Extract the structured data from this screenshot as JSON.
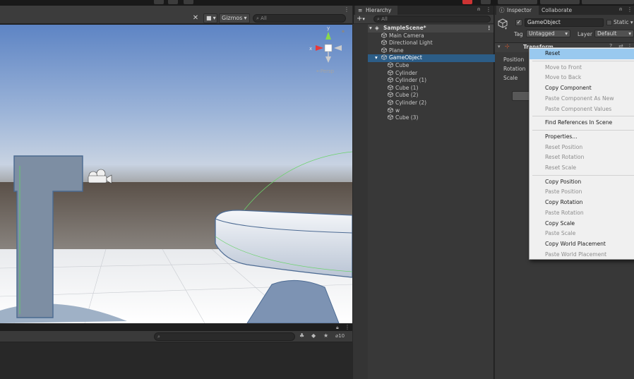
{
  "scene": {
    "gizmos_label": "Gizmos",
    "search_placeholder": "All",
    "persp_label": "←Persp"
  },
  "bottom": {
    "search_placeholder": "",
    "count": "10"
  },
  "hierarchy": {
    "tab": "Hierarchy",
    "add_label": "+",
    "search_placeholder": "All",
    "scene_name": "SampleScene*",
    "items": [
      {
        "label": "Main Camera",
        "depth": 1,
        "selected": false
      },
      {
        "label": "Directional Light",
        "depth": 1,
        "selected": false
      },
      {
        "label": "Plane",
        "depth": 1,
        "selected": false
      },
      {
        "label": "GameObject",
        "depth": 1,
        "selected": true
      },
      {
        "label": "Cube",
        "depth": 2,
        "selected": false
      },
      {
        "label": "Cylinder",
        "depth": 2,
        "selected": false
      },
      {
        "label": "Cylinder (1)",
        "depth": 2,
        "selected": false
      },
      {
        "label": "Cube (1)",
        "depth": 2,
        "selected": false
      },
      {
        "label": "Cube (2)",
        "depth": 2,
        "selected": false
      },
      {
        "label": "Cylinder (2)",
        "depth": 2,
        "selected": false
      },
      {
        "label": "w",
        "depth": 2,
        "selected": false
      },
      {
        "label": "Cube (3)",
        "depth": 2,
        "selected": false
      }
    ]
  },
  "inspector": {
    "tab_inspector": "Inspector",
    "tab_collaborate": "Collaborate",
    "object_name": "GameObject",
    "static_label": "Static",
    "tag_label": "Tag",
    "tag_value": "Untagged",
    "layer_label": "Layer",
    "layer_value": "Default",
    "component_title": "Transform",
    "rows": [
      "Position",
      "Rotation",
      "Scale"
    ]
  },
  "context_menu": {
    "items": [
      {
        "label": "Reset",
        "enabled": true,
        "highlighted": true
      },
      {
        "sep": true
      },
      {
        "label": "Move to Front",
        "enabled": false
      },
      {
        "label": "Move to Back",
        "enabled": false
      },
      {
        "label": "Copy Component",
        "enabled": true
      },
      {
        "label": "Paste Component As New",
        "enabled": false
      },
      {
        "label": "Paste Component Values",
        "enabled": false
      },
      {
        "sep": true
      },
      {
        "label": "Find References In Scene",
        "enabled": true
      },
      {
        "sep": true
      },
      {
        "label": "Properties...",
        "enabled": true
      },
      {
        "label": "Reset Position",
        "enabled": false
      },
      {
        "label": "Reset Rotation",
        "enabled": false
      },
      {
        "label": "Reset Scale",
        "enabled": false
      },
      {
        "sep": true
      },
      {
        "label": "Copy Position",
        "enabled": true
      },
      {
        "label": "Paste Position",
        "enabled": false
      },
      {
        "label": "Copy Rotation",
        "enabled": true
      },
      {
        "label": "Paste Rotation",
        "enabled": false
      },
      {
        "label": "Copy Scale",
        "enabled": true
      },
      {
        "label": "Paste Scale",
        "enabled": false
      },
      {
        "label": "Copy World Placement",
        "enabled": true
      },
      {
        "label": "Paste World Placement",
        "enabled": false
      }
    ]
  },
  "colors": {
    "selection": "#2c5d87",
    "menu_highlight": "#99c9ef",
    "panel_bg": "#383838"
  }
}
